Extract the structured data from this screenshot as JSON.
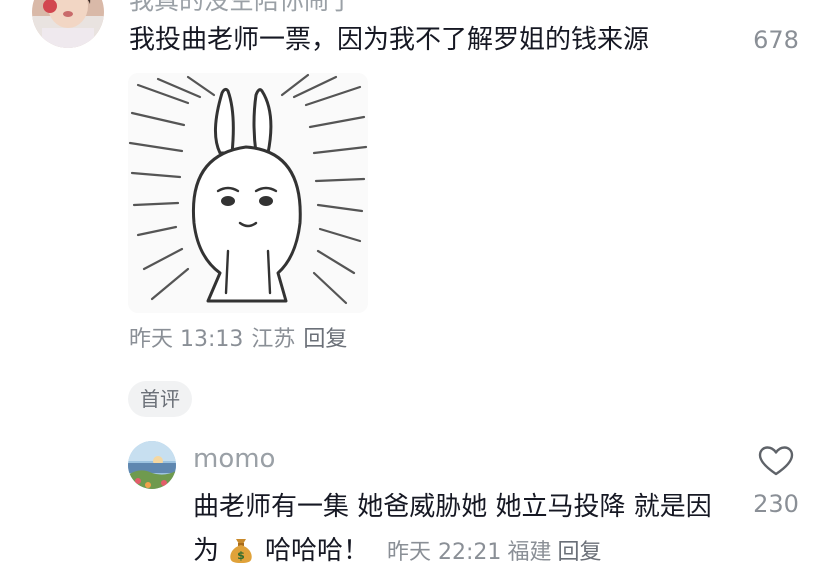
{
  "comments": [
    {
      "author": "我真的没空陪你闹了",
      "text": "我投曲老师一票，因为我不了解罗姐的钱来源",
      "likes": "678",
      "time": "昨天 13:13",
      "location": "江苏",
      "reply": "回复",
      "has_sticker": true
    },
    {
      "author": "momo",
      "text_before": "曲老师有一集 她爸威胁她 她立马投降 就是因为",
      "emoji": "money-bag-icon",
      "text_after": "哈哈哈！",
      "likes": "230",
      "time": "昨天 22:21",
      "location": "福建",
      "reply": "回复"
    }
  ],
  "section_tag": "首评",
  "colors": {
    "text_primary": "#161823",
    "text_secondary": "#8a8f96",
    "tag_bg": "#f1f2f3"
  }
}
